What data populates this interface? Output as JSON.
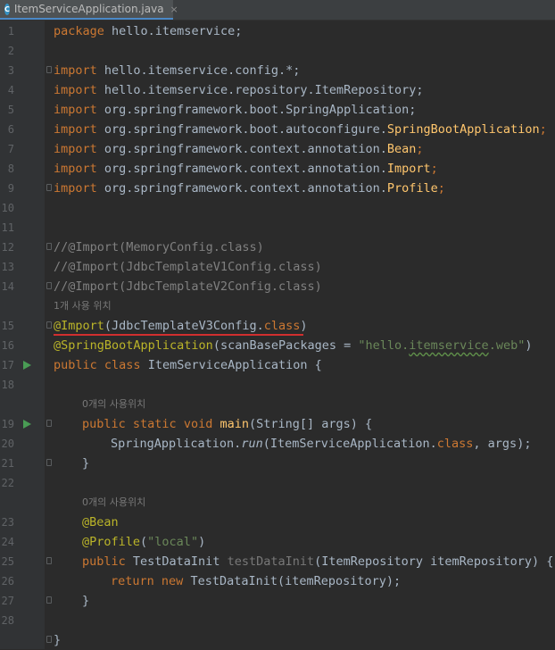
{
  "tab": {
    "filename": "ItemServiceApplication.java",
    "close": "×",
    "icon": "C"
  },
  "lines": [
    {
      "n": "1"
    },
    {
      "n": "2"
    },
    {
      "n": "3"
    },
    {
      "n": "4"
    },
    {
      "n": "5"
    },
    {
      "n": "6"
    },
    {
      "n": "7"
    },
    {
      "n": "8"
    },
    {
      "n": "9"
    },
    {
      "n": "10"
    },
    {
      "n": "11"
    },
    {
      "n": "12"
    },
    {
      "n": "13"
    },
    {
      "n": "14"
    },
    {
      "n": "15"
    },
    {
      "n": "16"
    },
    {
      "n": "17"
    },
    {
      "n": "18"
    },
    {
      "n": "19"
    },
    {
      "n": "20"
    },
    {
      "n": "21"
    },
    {
      "n": "22"
    },
    {
      "n": "23"
    },
    {
      "n": "24"
    },
    {
      "n": "25"
    },
    {
      "n": "26"
    },
    {
      "n": "27"
    },
    {
      "n": "28"
    }
  ],
  "code": {
    "l1": [
      "package",
      " hello.itemservice;"
    ],
    "l3": [
      "import",
      " hello.itemservice.config.*;"
    ],
    "l4": [
      "import",
      " hello.itemservice.repository.ItemRepository;"
    ],
    "l5": [
      "import",
      " org.springframework.boot.SpringApplication;"
    ],
    "l6": [
      "import",
      " org.springframework.boot.autoconfigure.",
      "SpringBootApplication",
      ";"
    ],
    "l7": [
      "import",
      " org.springframework.context.annotation.",
      "Bean",
      ";"
    ],
    "l8": [
      "import",
      " org.springframework.context.annotation.",
      "Import",
      ";"
    ],
    "l9": [
      "import",
      " org.springframework.context.annotation.",
      "Profile",
      ";"
    ],
    "l12": "//@Import(MemoryConfig.class)",
    "l13": "//@Import(JdbcTemplateV1Config.class)",
    "l14": "//@Import(JdbcTemplateV2Config.class)",
    "hint15": "1개 사용 위치",
    "l15": [
      "@Import",
      "(JdbcTemplateV3Config.",
      "class",
      ")"
    ],
    "l16": [
      "@SpringBootApplication",
      "(scanBasePackages = ",
      "\"hello.",
      "itemservice",
      ".web\"",
      ")"
    ],
    "l17": [
      "public",
      " ",
      "class",
      " ItemServiceApplication {"
    ],
    "hint19": "0개의 사용위치",
    "l19": [
      "public",
      " ",
      "static",
      " ",
      "void",
      " ",
      "main",
      "(String[] args) {"
    ],
    "l20": [
      "SpringApplication.",
      "run",
      "(ItemServiceApplication.",
      "class",
      ", args);"
    ],
    "l21": "}",
    "hint23": "0개의 사용위치",
    "l23": "@Bean",
    "l24": [
      "@Profile",
      "(",
      "\"local\"",
      ")"
    ],
    "l25": [
      "public",
      " TestDataInit ",
      "testDataInit",
      "(ItemRepository itemRepository) {"
    ],
    "l26": [
      "return",
      " ",
      "new",
      " TestDataInit(itemRepository);"
    ],
    "l27": "}",
    "l28": "}"
  },
  "colors": {
    "background": "#2b2b2b",
    "keyword": "#cc7832",
    "annotation": "#bbb529",
    "string": "#6a8759",
    "comment": "#808080",
    "method": "#ffc66d",
    "run_icon": "#499c54",
    "error_underline": "#d12f2f"
  },
  "icons": [
    "java-class-icon",
    "run-gutter-icon",
    "fold-marker-icon"
  ]
}
